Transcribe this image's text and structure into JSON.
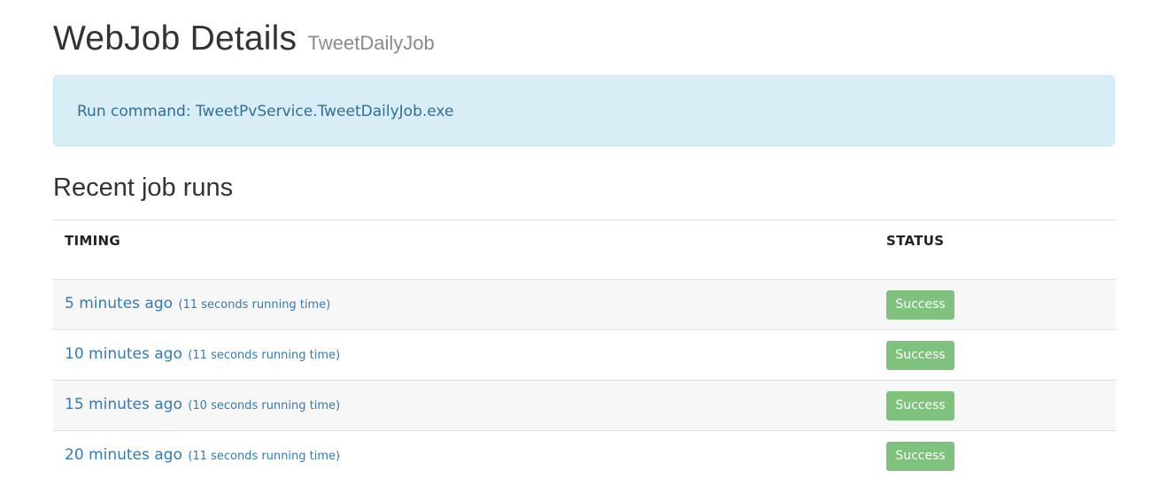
{
  "header": {
    "title": "WebJob Details",
    "subtitle": "TweetDailyJob"
  },
  "info": {
    "run_command": "Run command: TweetPvService.TweetDailyJob.exe"
  },
  "section": {
    "title": "Recent job runs"
  },
  "table": {
    "columns": [
      "TIMING",
      "STATUS"
    ],
    "rows": [
      {
        "timing": "5 minutes ago",
        "duration": "(11 seconds running time)",
        "status": "Success"
      },
      {
        "timing": "10 minutes ago",
        "duration": "(11 seconds running time)",
        "status": "Success"
      },
      {
        "timing": "15 minutes ago",
        "duration": "(10 seconds running time)",
        "status": "Success"
      },
      {
        "timing": "20 minutes ago",
        "duration": "(11 seconds running time)",
        "status": "Success"
      }
    ]
  },
  "colors": {
    "info_bg": "#d9edf7",
    "link": "#337ab7",
    "success": "#7ec27e"
  }
}
